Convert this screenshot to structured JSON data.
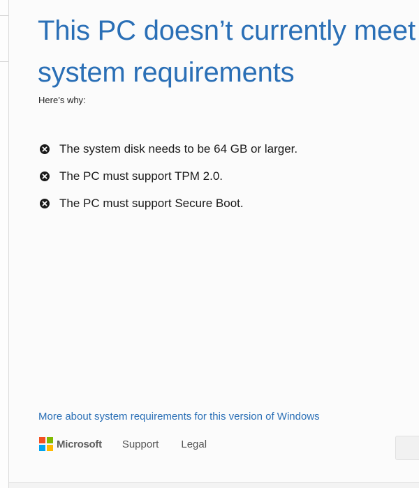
{
  "dialog": {
    "title_line1": "This PC doesn’t currently meet",
    "title_line2": "system requirements",
    "subtitle": "Here’s why:",
    "reasons": [
      {
        "icon": "error-x-icon",
        "text": "The system disk needs to be 64 GB or larger."
      },
      {
        "icon": "error-x-icon",
        "text": "The PC must support TPM 2.0."
      },
      {
        "icon": "error-x-icon",
        "text": "The PC must support Secure Boot."
      }
    ],
    "more_link": "More about system requirements for this version of Windows"
  },
  "footer": {
    "brand": "Microsoft",
    "brand_colors": [
      "#f25022",
      "#7fba00",
      "#00a4ef",
      "#ffb900"
    ],
    "support_label": "Support",
    "legal_label": "Legal"
  },
  "colors": {
    "accent": "#2a6fb6",
    "icon": "#1a1a1a"
  }
}
